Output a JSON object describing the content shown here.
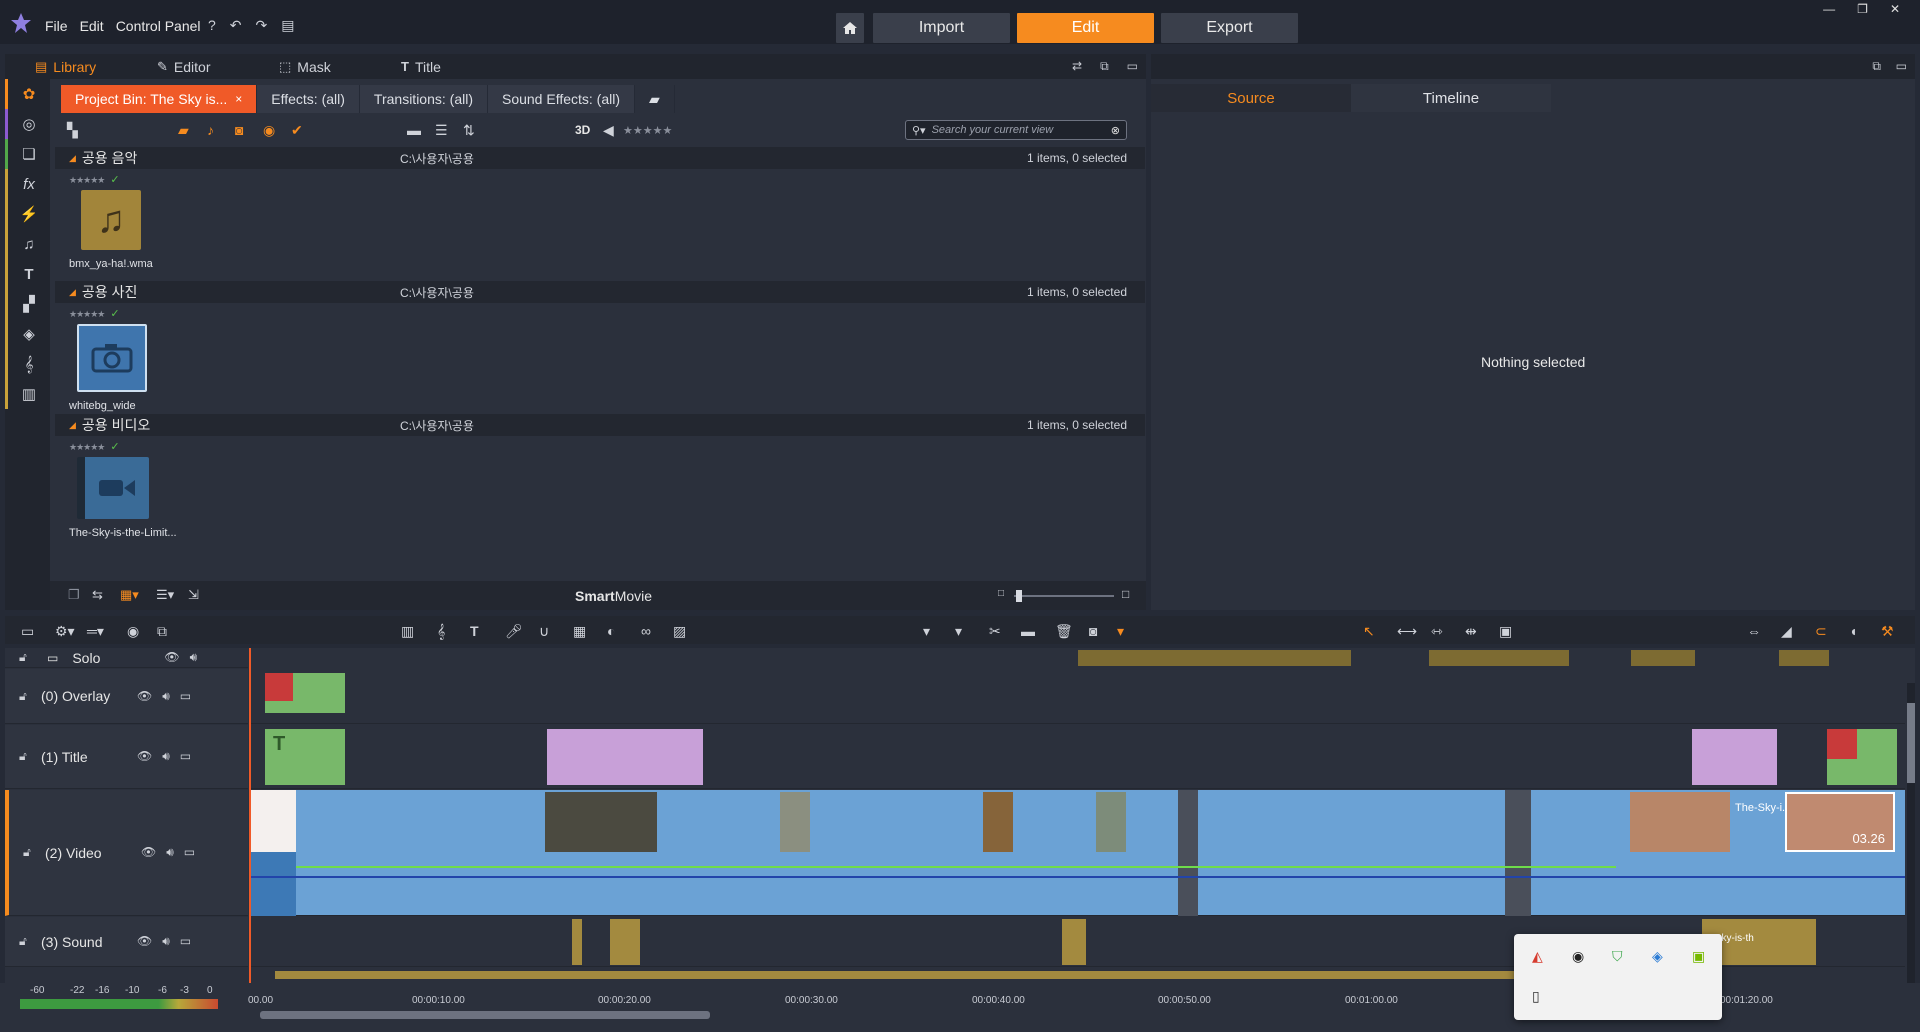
{
  "menu": {
    "file": "File",
    "edit": "Edit",
    "control_panel": "Control Panel"
  },
  "modes": {
    "import": "Import",
    "edit": "Edit",
    "export": "Export"
  },
  "lib_tabs": [
    {
      "label": "Library",
      "icon": "library-icon"
    },
    {
      "label": "Editor",
      "icon": "editor-icon"
    },
    {
      "label": "Mask",
      "icon": "mask-icon"
    },
    {
      "label": "Title",
      "icon": "title-icon"
    }
  ],
  "bin_tabs": [
    {
      "label": "Project Bin: The Sky is...",
      "close": "×"
    },
    {
      "label": "Effects: (all)"
    },
    {
      "label": "Transitions: (all)"
    },
    {
      "label": "Sound Effects: (all)"
    }
  ],
  "bin_toolbar": {
    "label_3d": "3D"
  },
  "search": {
    "placeholder": "Search your current view"
  },
  "groups": [
    {
      "title": "공용 음악",
      "path": "C:\\사용자\\공용",
      "count": "1 items, 0 selected",
      "item_name": "bmx_ya-ha!.wma",
      "kind": "music",
      "stars": "★★★★★",
      "check": "✓"
    },
    {
      "title": "공용 사진",
      "path": "C:\\사용자\\공용",
      "count": "1 items, 0 selected",
      "item_name": "whitebg_wide",
      "kind": "photo",
      "stars": "★★★★★",
      "check": "✓"
    },
    {
      "title": "공용 비디오",
      "path": "C:\\사용자\\공용",
      "count": "1 items, 0 selected",
      "item_name": "The-Sky-is-the-Limit...",
      "kind": "video",
      "stars": "★★★★★",
      "check": "✓"
    }
  ],
  "library_footer": {
    "smart_bold": "Smart",
    "smart_rest": "Movie"
  },
  "preview": {
    "tabs": {
      "source": "Source",
      "timeline": "Timeline"
    },
    "empty_text": "Nothing selected"
  },
  "tracks": [
    {
      "name": "Solo"
    },
    {
      "name": "(0) Overlay"
    },
    {
      "name": "(1) Title"
    },
    {
      "name": "(2) Video"
    },
    {
      "name": "(3) Sound"
    }
  ],
  "timeline_labels": {
    "clip_title": "The-Sky-i...",
    "clip_duration": "03.26",
    "sound_clip": "e-Sky-is-th"
  },
  "ruler_ticks": [
    "00.00",
    "00:00:10.00",
    "00:00:20.00",
    "00:00:30.00",
    "00:00:40.00",
    "00:00:50.00",
    "00:01:00.00",
    "00:01:20.00"
  ],
  "meter_labels": [
    "-60",
    "-22",
    "-16",
    "-10",
    "-6",
    "-3",
    "0"
  ],
  "colors": {
    "accent": "#f68b1f",
    "active_bin_tab": "#f05a28",
    "video_clip": "#6ba2d5",
    "overlay_clip": "#c8a0d8",
    "sound_clip": "#a38a3f"
  }
}
